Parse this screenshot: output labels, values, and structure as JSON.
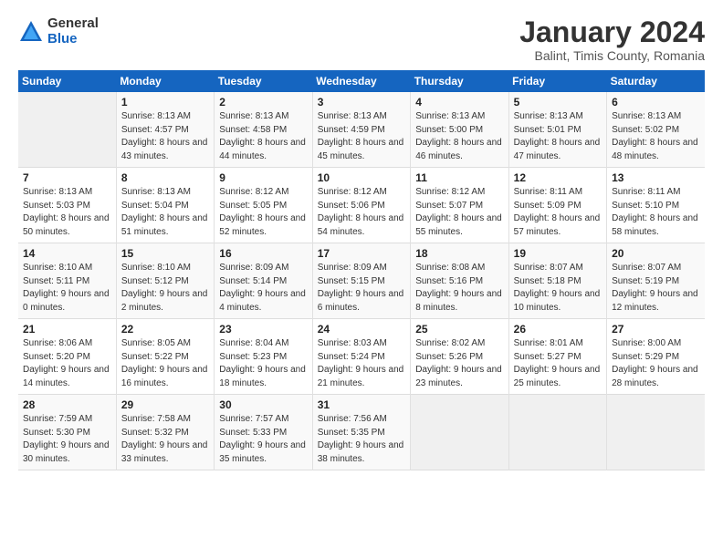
{
  "logo": {
    "general": "General",
    "blue": "Blue"
  },
  "title": "January 2024",
  "subtitle": "Balint, Timis County, Romania",
  "days_header": [
    "Sunday",
    "Monday",
    "Tuesday",
    "Wednesday",
    "Thursday",
    "Friday",
    "Saturday"
  ],
  "weeks": [
    [
      {
        "num": "",
        "sunrise": "",
        "sunset": "",
        "daylight": ""
      },
      {
        "num": "1",
        "sunrise": "Sunrise: 8:13 AM",
        "sunset": "Sunset: 4:57 PM",
        "daylight": "Daylight: 8 hours and 43 minutes."
      },
      {
        "num": "2",
        "sunrise": "Sunrise: 8:13 AM",
        "sunset": "Sunset: 4:58 PM",
        "daylight": "Daylight: 8 hours and 44 minutes."
      },
      {
        "num": "3",
        "sunrise": "Sunrise: 8:13 AM",
        "sunset": "Sunset: 4:59 PM",
        "daylight": "Daylight: 8 hours and 45 minutes."
      },
      {
        "num": "4",
        "sunrise": "Sunrise: 8:13 AM",
        "sunset": "Sunset: 5:00 PM",
        "daylight": "Daylight: 8 hours and 46 minutes."
      },
      {
        "num": "5",
        "sunrise": "Sunrise: 8:13 AM",
        "sunset": "Sunset: 5:01 PM",
        "daylight": "Daylight: 8 hours and 47 minutes."
      },
      {
        "num": "6",
        "sunrise": "Sunrise: 8:13 AM",
        "sunset": "Sunset: 5:02 PM",
        "daylight": "Daylight: 8 hours and 48 minutes."
      }
    ],
    [
      {
        "num": "7",
        "sunrise": "Sunrise: 8:13 AM",
        "sunset": "Sunset: 5:03 PM",
        "daylight": "Daylight: 8 hours and 50 minutes."
      },
      {
        "num": "8",
        "sunrise": "Sunrise: 8:13 AM",
        "sunset": "Sunset: 5:04 PM",
        "daylight": "Daylight: 8 hours and 51 minutes."
      },
      {
        "num": "9",
        "sunrise": "Sunrise: 8:12 AM",
        "sunset": "Sunset: 5:05 PM",
        "daylight": "Daylight: 8 hours and 52 minutes."
      },
      {
        "num": "10",
        "sunrise": "Sunrise: 8:12 AM",
        "sunset": "Sunset: 5:06 PM",
        "daylight": "Daylight: 8 hours and 54 minutes."
      },
      {
        "num": "11",
        "sunrise": "Sunrise: 8:12 AM",
        "sunset": "Sunset: 5:07 PM",
        "daylight": "Daylight: 8 hours and 55 minutes."
      },
      {
        "num": "12",
        "sunrise": "Sunrise: 8:11 AM",
        "sunset": "Sunset: 5:09 PM",
        "daylight": "Daylight: 8 hours and 57 minutes."
      },
      {
        "num": "13",
        "sunrise": "Sunrise: 8:11 AM",
        "sunset": "Sunset: 5:10 PM",
        "daylight": "Daylight: 8 hours and 58 minutes."
      }
    ],
    [
      {
        "num": "14",
        "sunrise": "Sunrise: 8:10 AM",
        "sunset": "Sunset: 5:11 PM",
        "daylight": "Daylight: 9 hours and 0 minutes."
      },
      {
        "num": "15",
        "sunrise": "Sunrise: 8:10 AM",
        "sunset": "Sunset: 5:12 PM",
        "daylight": "Daylight: 9 hours and 2 minutes."
      },
      {
        "num": "16",
        "sunrise": "Sunrise: 8:09 AM",
        "sunset": "Sunset: 5:14 PM",
        "daylight": "Daylight: 9 hours and 4 minutes."
      },
      {
        "num": "17",
        "sunrise": "Sunrise: 8:09 AM",
        "sunset": "Sunset: 5:15 PM",
        "daylight": "Daylight: 9 hours and 6 minutes."
      },
      {
        "num": "18",
        "sunrise": "Sunrise: 8:08 AM",
        "sunset": "Sunset: 5:16 PM",
        "daylight": "Daylight: 9 hours and 8 minutes."
      },
      {
        "num": "19",
        "sunrise": "Sunrise: 8:07 AM",
        "sunset": "Sunset: 5:18 PM",
        "daylight": "Daylight: 9 hours and 10 minutes."
      },
      {
        "num": "20",
        "sunrise": "Sunrise: 8:07 AM",
        "sunset": "Sunset: 5:19 PM",
        "daylight": "Daylight: 9 hours and 12 minutes."
      }
    ],
    [
      {
        "num": "21",
        "sunrise": "Sunrise: 8:06 AM",
        "sunset": "Sunset: 5:20 PM",
        "daylight": "Daylight: 9 hours and 14 minutes."
      },
      {
        "num": "22",
        "sunrise": "Sunrise: 8:05 AM",
        "sunset": "Sunset: 5:22 PM",
        "daylight": "Daylight: 9 hours and 16 minutes."
      },
      {
        "num": "23",
        "sunrise": "Sunrise: 8:04 AM",
        "sunset": "Sunset: 5:23 PM",
        "daylight": "Daylight: 9 hours and 18 minutes."
      },
      {
        "num": "24",
        "sunrise": "Sunrise: 8:03 AM",
        "sunset": "Sunset: 5:24 PM",
        "daylight": "Daylight: 9 hours and 21 minutes."
      },
      {
        "num": "25",
        "sunrise": "Sunrise: 8:02 AM",
        "sunset": "Sunset: 5:26 PM",
        "daylight": "Daylight: 9 hours and 23 minutes."
      },
      {
        "num": "26",
        "sunrise": "Sunrise: 8:01 AM",
        "sunset": "Sunset: 5:27 PM",
        "daylight": "Daylight: 9 hours and 25 minutes."
      },
      {
        "num": "27",
        "sunrise": "Sunrise: 8:00 AM",
        "sunset": "Sunset: 5:29 PM",
        "daylight": "Daylight: 9 hours and 28 minutes."
      }
    ],
    [
      {
        "num": "28",
        "sunrise": "Sunrise: 7:59 AM",
        "sunset": "Sunset: 5:30 PM",
        "daylight": "Daylight: 9 hours and 30 minutes."
      },
      {
        "num": "29",
        "sunrise": "Sunrise: 7:58 AM",
        "sunset": "Sunset: 5:32 PM",
        "daylight": "Daylight: 9 hours and 33 minutes."
      },
      {
        "num": "30",
        "sunrise": "Sunrise: 7:57 AM",
        "sunset": "Sunset: 5:33 PM",
        "daylight": "Daylight: 9 hours and 35 minutes."
      },
      {
        "num": "31",
        "sunrise": "Sunrise: 7:56 AM",
        "sunset": "Sunset: 5:35 PM",
        "daylight": "Daylight: 9 hours and 38 minutes."
      },
      {
        "num": "",
        "sunrise": "",
        "sunset": "",
        "daylight": ""
      },
      {
        "num": "",
        "sunrise": "",
        "sunset": "",
        "daylight": ""
      },
      {
        "num": "",
        "sunrise": "",
        "sunset": "",
        "daylight": ""
      }
    ]
  ]
}
